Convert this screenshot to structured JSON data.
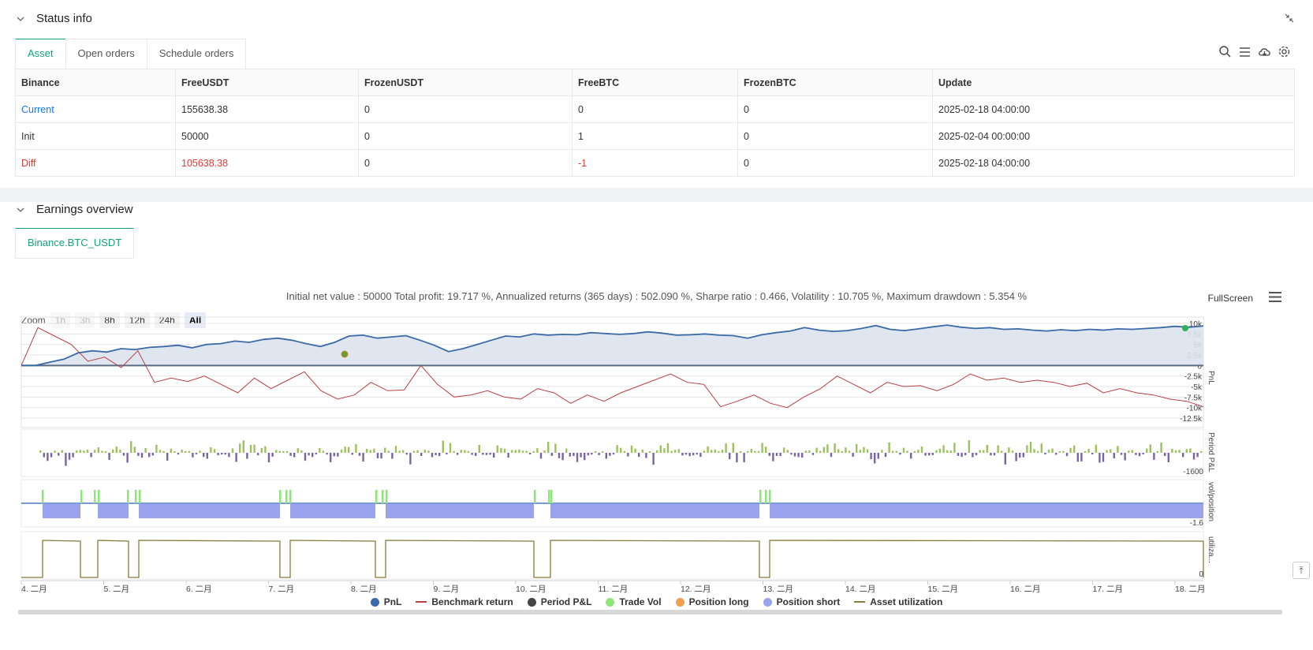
{
  "status": {
    "title": "Status info",
    "tabs": [
      "Asset",
      "Open orders",
      "Schedule orders"
    ],
    "columns": [
      "Binance",
      "FreeUSDT",
      "FrozenUSDT",
      "FreeBTC",
      "FrozenBTC",
      "Update"
    ],
    "rows": [
      [
        "Current",
        "155638.38",
        "0",
        "0",
        "0",
        "2025-02-18 04:00:00"
      ],
      [
        "Init",
        "50000",
        "0",
        "1",
        "0",
        "2025-02-04 00:00:00"
      ],
      [
        "Diff",
        "105638.38",
        "0",
        "-1",
        "0",
        "2025-02-18 04:00:00"
      ]
    ]
  },
  "earnings": {
    "title": "Earnings overview",
    "tab": "Binance.BTC_USDT",
    "summary": "Initial net value : 50000 Total profit: 19.717 %, Annualized returns (365 days) : 502.090 %, Sharpe ratio : 0.466, Volatility : 10.705 %, Maximum drawdown : 5.354 %",
    "fullscreen_label": "FullScreen",
    "zoom_label": "Zoom",
    "zoom_buttons": [
      "1h",
      "3h",
      "8h",
      "12h",
      "24h",
      "All"
    ],
    "legend": [
      "PnL",
      "Benchmark return",
      "Period P&L",
      "Trade Vol",
      "Position long",
      "Position short",
      "Asset utilization"
    ]
  },
  "chart_data": {
    "type": "line",
    "x_ticks": [
      "4. 二月",
      "5. 二月",
      "6. 二月",
      "7. 二月",
      "8. 二月",
      "9. 二月",
      "10. 二月",
      "11. 二月",
      "12. 二月",
      "13. 二月",
      "14. 二月",
      "15. 二月",
      "16. 二月",
      "17. 二月",
      "18. 二月"
    ],
    "pnl_axis": [
      "10k",
      "7.5k",
      "5k",
      "2.5k",
      "0",
      "-2.5k",
      "-5k",
      "-7.5k",
      "-10k",
      "-12.5k"
    ],
    "pnl_label": "PnL",
    "period_label": "Period P&L",
    "period_min": "-1600",
    "pos_label": "vol/position",
    "pos_min": "-1.6",
    "util_label": "utiliza...",
    "util_min": "0",
    "colors": {
      "pnl": "#3a6aa8",
      "benchmark": "#b84040",
      "period_pos": "#9cc25a",
      "period_neg": "#7b63a8",
      "trade_vol": "#8ee67a",
      "long": "#f0a04a",
      "short": "#9aa3ee",
      "util": "#8a7a3c"
    },
    "pnl_series": [
      0,
      0,
      800,
      1500,
      3000,
      3500,
      3200,
      4000,
      3800,
      4300,
      4500,
      4800,
      4200,
      5000,
      5200,
      5800,
      5500,
      6200,
      6500,
      6000,
      5200,
      4500,
      5500,
      7000,
      7200,
      6500,
      6800,
      7100,
      6000,
      4800,
      3300,
      4000,
      5000,
      6000,
      7000,
      6800,
      7500,
      7200,
      7400,
      7300,
      7800,
      7600,
      7400,
      7600,
      8000,
      7700,
      7200,
      7300,
      7500,
      7200,
      7100,
      6500,
      7300,
      7800,
      8200,
      9000,
      8400,
      8100,
      8300,
      8800,
      9500,
      8600,
      8300,
      8700,
      9200,
      9600,
      9100,
      8800,
      9000,
      8600,
      8700,
      8400,
      8200,
      8500,
      8300,
      8600,
      8400,
      8700,
      8600,
      8800,
      9000,
      9300,
      9100,
      9400
    ],
    "benchmark_series": [
      0,
      9000,
      7000,
      5000,
      1000,
      2000,
      -500,
      3500,
      -4000,
      -3000,
      -3800,
      -2500,
      -4500,
      -6500,
      -3000,
      -5500,
      -3500,
      -1500,
      -6000,
      -8000,
      -7000,
      -4000,
      -6000,
      -5800,
      0,
      -4500,
      -7500,
      -7000,
      -6000,
      -7500,
      -8000,
      -5500,
      -6500,
      -9000,
      -7000,
      -8500,
      -6500,
      -5000,
      -3500,
      -2000,
      -4000,
      -4500,
      -9800,
      -8500,
      -7000,
      -9000,
      -10000,
      -7500,
      -5500,
      -2500,
      -4500,
      -6500,
      -4000,
      -5000,
      -4800,
      -6000,
      -4500,
      -2000,
      -3500,
      -3000,
      -4000,
      -3500,
      -4000,
      -5000,
      -4200,
      -6500,
      -5500,
      -6500,
      -7000,
      -8000,
      -8500,
      -9800
    ]
  }
}
